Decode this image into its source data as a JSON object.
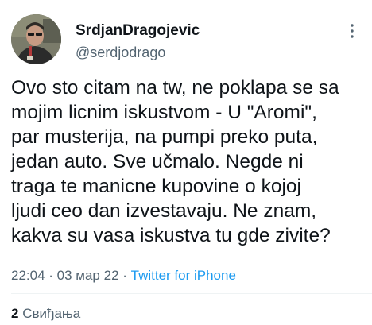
{
  "author": {
    "display_name": "SrdjanDragojevic",
    "handle": "@serdjodrago"
  },
  "icons": {
    "avatar": "profile-photo",
    "more": "more-dots-icon"
  },
  "tweet": {
    "lines": [
      "Ovo sto citam na tw, ne poklapa se sa",
      "mojim licnim iskustvom - U \"Aromi\",",
      "par musterija, na pumpi preko puta,",
      "jedan auto. Sve učmalo. Negde ni",
      "traga te manicne kupovine o kojoj",
      "ljudi ceo dan izvestavaju. Ne znam,",
      "kakva su vasa iskustva tu gde zivite?"
    ]
  },
  "meta": {
    "time": "22:04",
    "separator1": " · ",
    "date": "03 мар 22",
    "separator2": " · ",
    "source": "Twitter for iPhone"
  },
  "stats": {
    "like_count": "2",
    "like_label": "Свиђања"
  },
  "colors": {
    "text": "#0f1419",
    "secondary": "#536471",
    "link": "#1d9bf0",
    "divider": "#eff3f4"
  }
}
